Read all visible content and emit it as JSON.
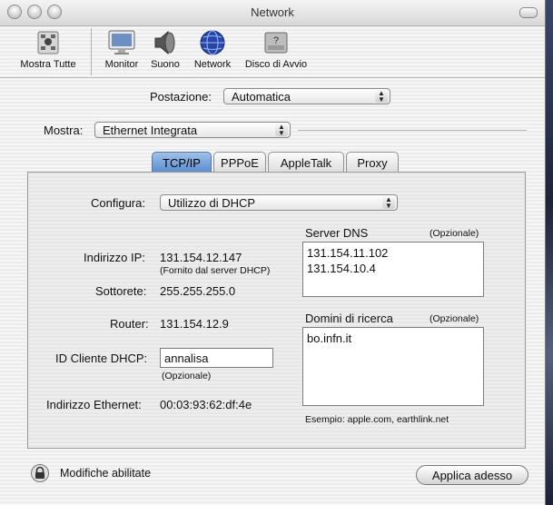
{
  "window": {
    "title": "Network"
  },
  "toolbar": {
    "show_all": "Mostra Tutte",
    "items": [
      {
        "label": "Monitor",
        "icon": "monitor-icon"
      },
      {
        "label": "Suono",
        "icon": "speaker-icon"
      },
      {
        "label": "Network",
        "icon": "globe-icon"
      },
      {
        "label": "Disco di Avvio",
        "icon": "disk-icon"
      }
    ]
  },
  "location": {
    "label": "Postazione:",
    "value": "Automatica"
  },
  "show": {
    "label": "Mostra:",
    "value": "Ethernet Integrata"
  },
  "tabs": [
    "TCP/IP",
    "PPPoE",
    "AppleTalk",
    "Proxy"
  ],
  "tcpip": {
    "configure_label": "Configura:",
    "configure_value": "Utilizzo di DHCP",
    "ip_label": "Indirizzo IP:",
    "ip_value": "131.154.12.147",
    "ip_note": "(Fornito dal server DHCP)",
    "subnet_label": "Sottorete:",
    "subnet_value": "255.255.255.0",
    "router_label": "Router:",
    "router_value": "131.154.12.9",
    "dhcp_client_label": "ID Cliente DHCP:",
    "dhcp_client_value": "annalisa",
    "dhcp_client_note": "(Opzionale)",
    "ethernet_label": "Indirizzo Ethernet:",
    "ethernet_value": "00:03:93:62:df:4e",
    "dns_label": "Server DNS",
    "dns_optional": "(Opzionale)",
    "dns_servers": [
      "131.154.11.102",
      "131.154.10.4"
    ],
    "search_label": "Domini di ricerca",
    "search_optional": "(Opzionale)",
    "search_domains": [
      "bo.infn.it"
    ],
    "example": "Esempio: apple.com, earthlink.net"
  },
  "footer": {
    "lock_label": "Modifiche abilitate",
    "apply": "Applica adesso"
  },
  "colors": {
    "active_tab": "#5b8fd0",
    "background": "#ececec"
  }
}
